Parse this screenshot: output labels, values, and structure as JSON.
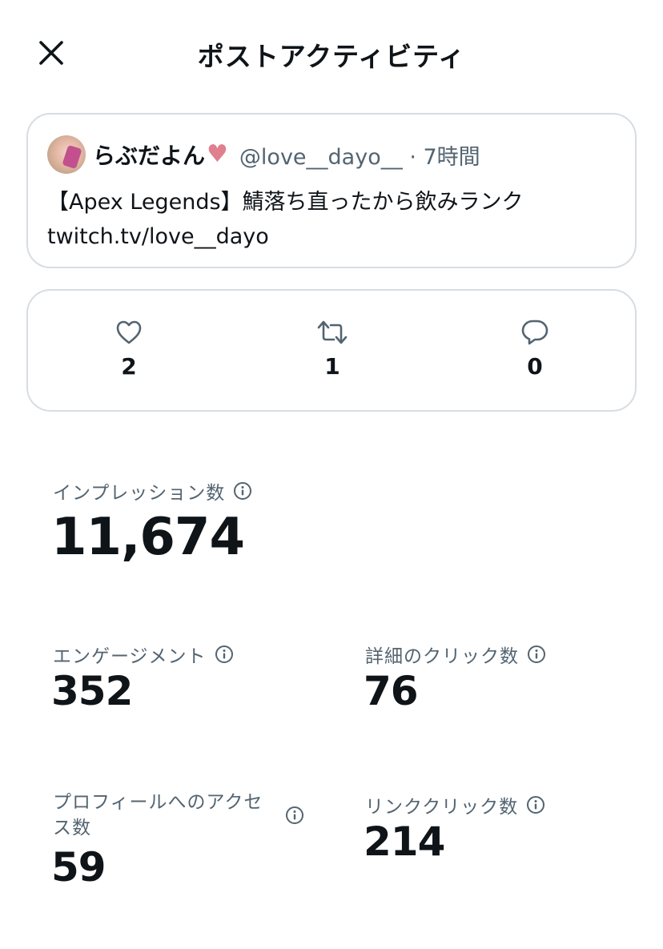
{
  "header": {
    "title": "ポストアクティビティ",
    "close_icon": "close-icon"
  },
  "post": {
    "display_name": "らぶだよん",
    "name_emoji": "♥",
    "handle": "@love__dayo__",
    "separator": "·",
    "time": "7時間",
    "text_line1": "【Apex Legends】鯖落ち直ったから飲みランク",
    "text_line2": "twitch.tv/love__dayo"
  },
  "engagement_counts": {
    "likes": "2",
    "reposts": "1",
    "replies": "0"
  },
  "stats": {
    "impressions_label": "インプレッション数",
    "impressions_value": "11,674",
    "engagements_label": "エンゲージメント",
    "engagements_value": "352",
    "detail_clicks_label": "詳細のクリック数",
    "detail_clicks_value": "76",
    "profile_visits_label": "プロフィールへのアクセス数",
    "profile_visits_value": "59",
    "link_clicks_label": "リンククリック数",
    "link_clicks_value": "214"
  },
  "colors": {
    "text_primary": "#0f1419",
    "text_secondary": "#536471",
    "border": "#d7dde2",
    "heart_emoji": "#e07f8d"
  }
}
